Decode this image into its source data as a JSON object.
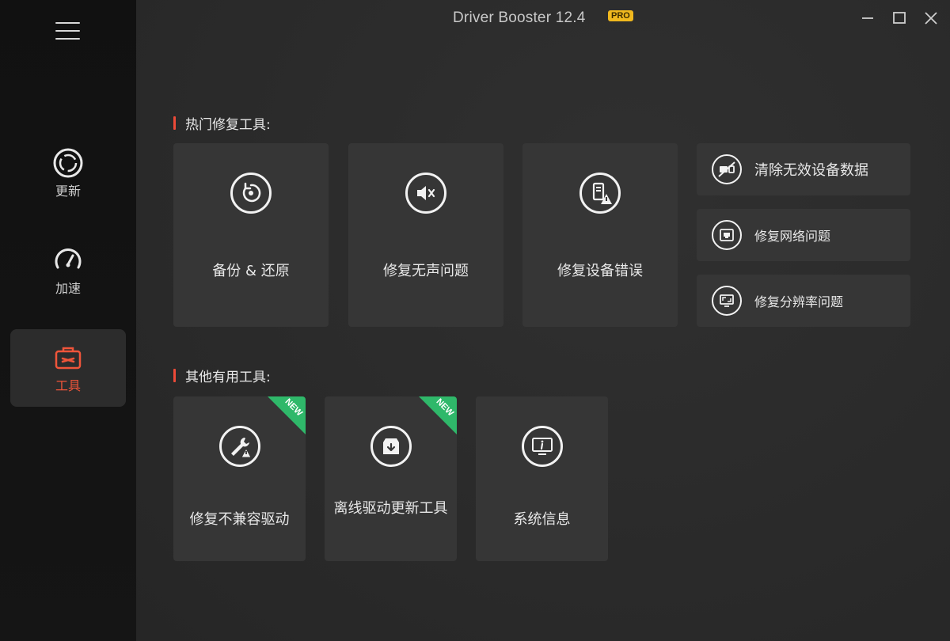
{
  "app": {
    "title": "Driver Booster 12.4",
    "badge": "PRO"
  },
  "sidebar": {
    "items": [
      {
        "label": "更新",
        "icon": "update-icon"
      },
      {
        "label": "加速",
        "icon": "speedometer-icon"
      },
      {
        "label": "工具",
        "icon": "toolbox-icon",
        "active": true
      }
    ]
  },
  "hot_tools": {
    "heading": "热门修复工具:",
    "cards": [
      {
        "label": "备份 & 还原",
        "icon": "backup-restore-icon"
      },
      {
        "label": "修复无声问题",
        "icon": "mute-speaker-icon"
      },
      {
        "label": "修复设备错误",
        "icon": "device-error-icon"
      }
    ],
    "side_cards": [
      {
        "label": "清除无效设备数据",
        "icon": "disconnected-device-icon"
      },
      {
        "label": "修复网络问题",
        "icon": "network-port-icon"
      },
      {
        "label": "修复分辨率问题",
        "icon": "screen-resolution-icon"
      }
    ]
  },
  "other_tools": {
    "heading": "其他有用工具:",
    "cards": [
      {
        "label": "修复不兼容驱动",
        "icon": "wrench-warning-icon",
        "badge": "NEW"
      },
      {
        "label": "离线驱动更新工具",
        "icon": "offline-download-icon",
        "badge": "NEW"
      },
      {
        "label": "系统信息",
        "icon": "system-info-icon"
      }
    ]
  },
  "colors": {
    "accent": "#ec4a38",
    "new_badge": "#2fb86a",
    "pro_badge": "#f0b81e"
  }
}
